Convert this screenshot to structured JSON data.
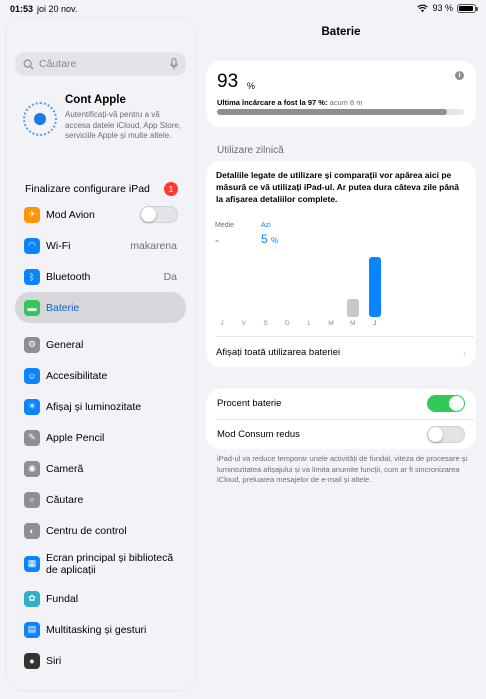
{
  "status_bar": {
    "time": "01:53",
    "date": "joi 20 nov.",
    "battery_text": "93 %",
    "battery_level": 0.93
  },
  "sidebar": {
    "search_placeholder": "Căutare",
    "account": {
      "title": "Cont Apple",
      "description": "Autentificați-vă pentru a vă accesa datele iCloud, App Store, serviciile Apple și multe altele."
    },
    "setup": {
      "label": "Finalizare configurare iPad",
      "badge": "1"
    },
    "items": [
      {
        "label": "Mod Avion",
        "icon": "airplane-icon",
        "color": "#ff9500",
        "toggle": false
      },
      {
        "label": "Wi-Fi",
        "icon": "wifi-icon",
        "color": "#0a84ff",
        "value": "makarena"
      },
      {
        "label": "Bluetooth",
        "icon": "bluetooth-icon",
        "color": "#0a84ff",
        "value": "Da"
      },
      {
        "label": "Baterie",
        "icon": "battery-icon",
        "color": "#34c759",
        "selected": true
      },
      {
        "label": "General",
        "icon": "gear-icon",
        "color": "#8e8e93"
      },
      {
        "label": "Accesibilitate",
        "icon": "accessibility-icon",
        "color": "#0a84ff"
      },
      {
        "label": "Afișaj și luminozitate",
        "icon": "sun-icon",
        "color": "#0a84ff"
      },
      {
        "label": "Apple Pencil",
        "icon": "pencil-icon",
        "color": "#8e8e93"
      },
      {
        "label": "Cameră",
        "icon": "camera-icon",
        "color": "#8e8e93"
      },
      {
        "label": "Căutare",
        "icon": "search-icon",
        "color": "#8e8e93"
      },
      {
        "label": "Centru de control",
        "icon": "control-center-icon",
        "color": "#8e8e93"
      },
      {
        "label": "Ecran principal și bibliotecă de aplicații",
        "icon": "home-screen-icon",
        "color": "#0a84ff"
      },
      {
        "label": "Fundal",
        "icon": "wallpaper-icon",
        "color": "#30b0c7"
      },
      {
        "label": "Multitasking și gesturi",
        "icon": "multitasking-icon",
        "color": "#0a84ff"
      },
      {
        "label": "Siri",
        "icon": "siri-icon",
        "color": "#333333"
      }
    ]
  },
  "main": {
    "title": "Baterie",
    "battery": {
      "percent": "93",
      "unit": "%",
      "level": 0.93,
      "last_charge": "Ultima încărcare a fost la 97 %:",
      "last_charge_ago": "acum 8 m",
      "info_glyph": "i"
    },
    "usage": {
      "section_title": "Utilizare zilnică",
      "note": "Detaliile legate de utilizare și comparații vor apărea aici pe măsură ce vă utilizați iPad-ul. Ar putea dura câteva zile până la afișarea detaliilor complete.",
      "avg_label": "Medie",
      "avg_value": "-",
      "today_label": "Azi",
      "today_value": "5",
      "today_unit": "%",
      "show_all": "Afișați toată utilizarea bateriei",
      "chevron": "›"
    },
    "settings": {
      "percent_label": "Procent baterie",
      "percent_on": true,
      "low_power_label": "Mod Consum redus",
      "low_power_on": false,
      "footnote": "iPad-ul va reduce temporar unele activități de fundal, viteza de procesare și luminozitatea afișajului și va limita anumite funcții, cum ar fi sincronizarea iCloud, preluarea mesajelor de e-mail și altele."
    }
  },
  "chart_data": {
    "type": "bar",
    "categories": [
      "J",
      "V",
      "S",
      "D",
      "L",
      "M",
      "M",
      "J"
    ],
    "values": [
      0,
      0,
      0,
      0,
      0,
      0,
      1.5,
      5
    ],
    "colors": [
      "#c7c7cc",
      "#c7c7cc",
      "#c7c7cc",
      "#c7c7cc",
      "#c7c7cc",
      "#c7c7cc",
      "#c7c7cc",
      "#0a84ff"
    ],
    "ylim": [
      0,
      5
    ]
  }
}
